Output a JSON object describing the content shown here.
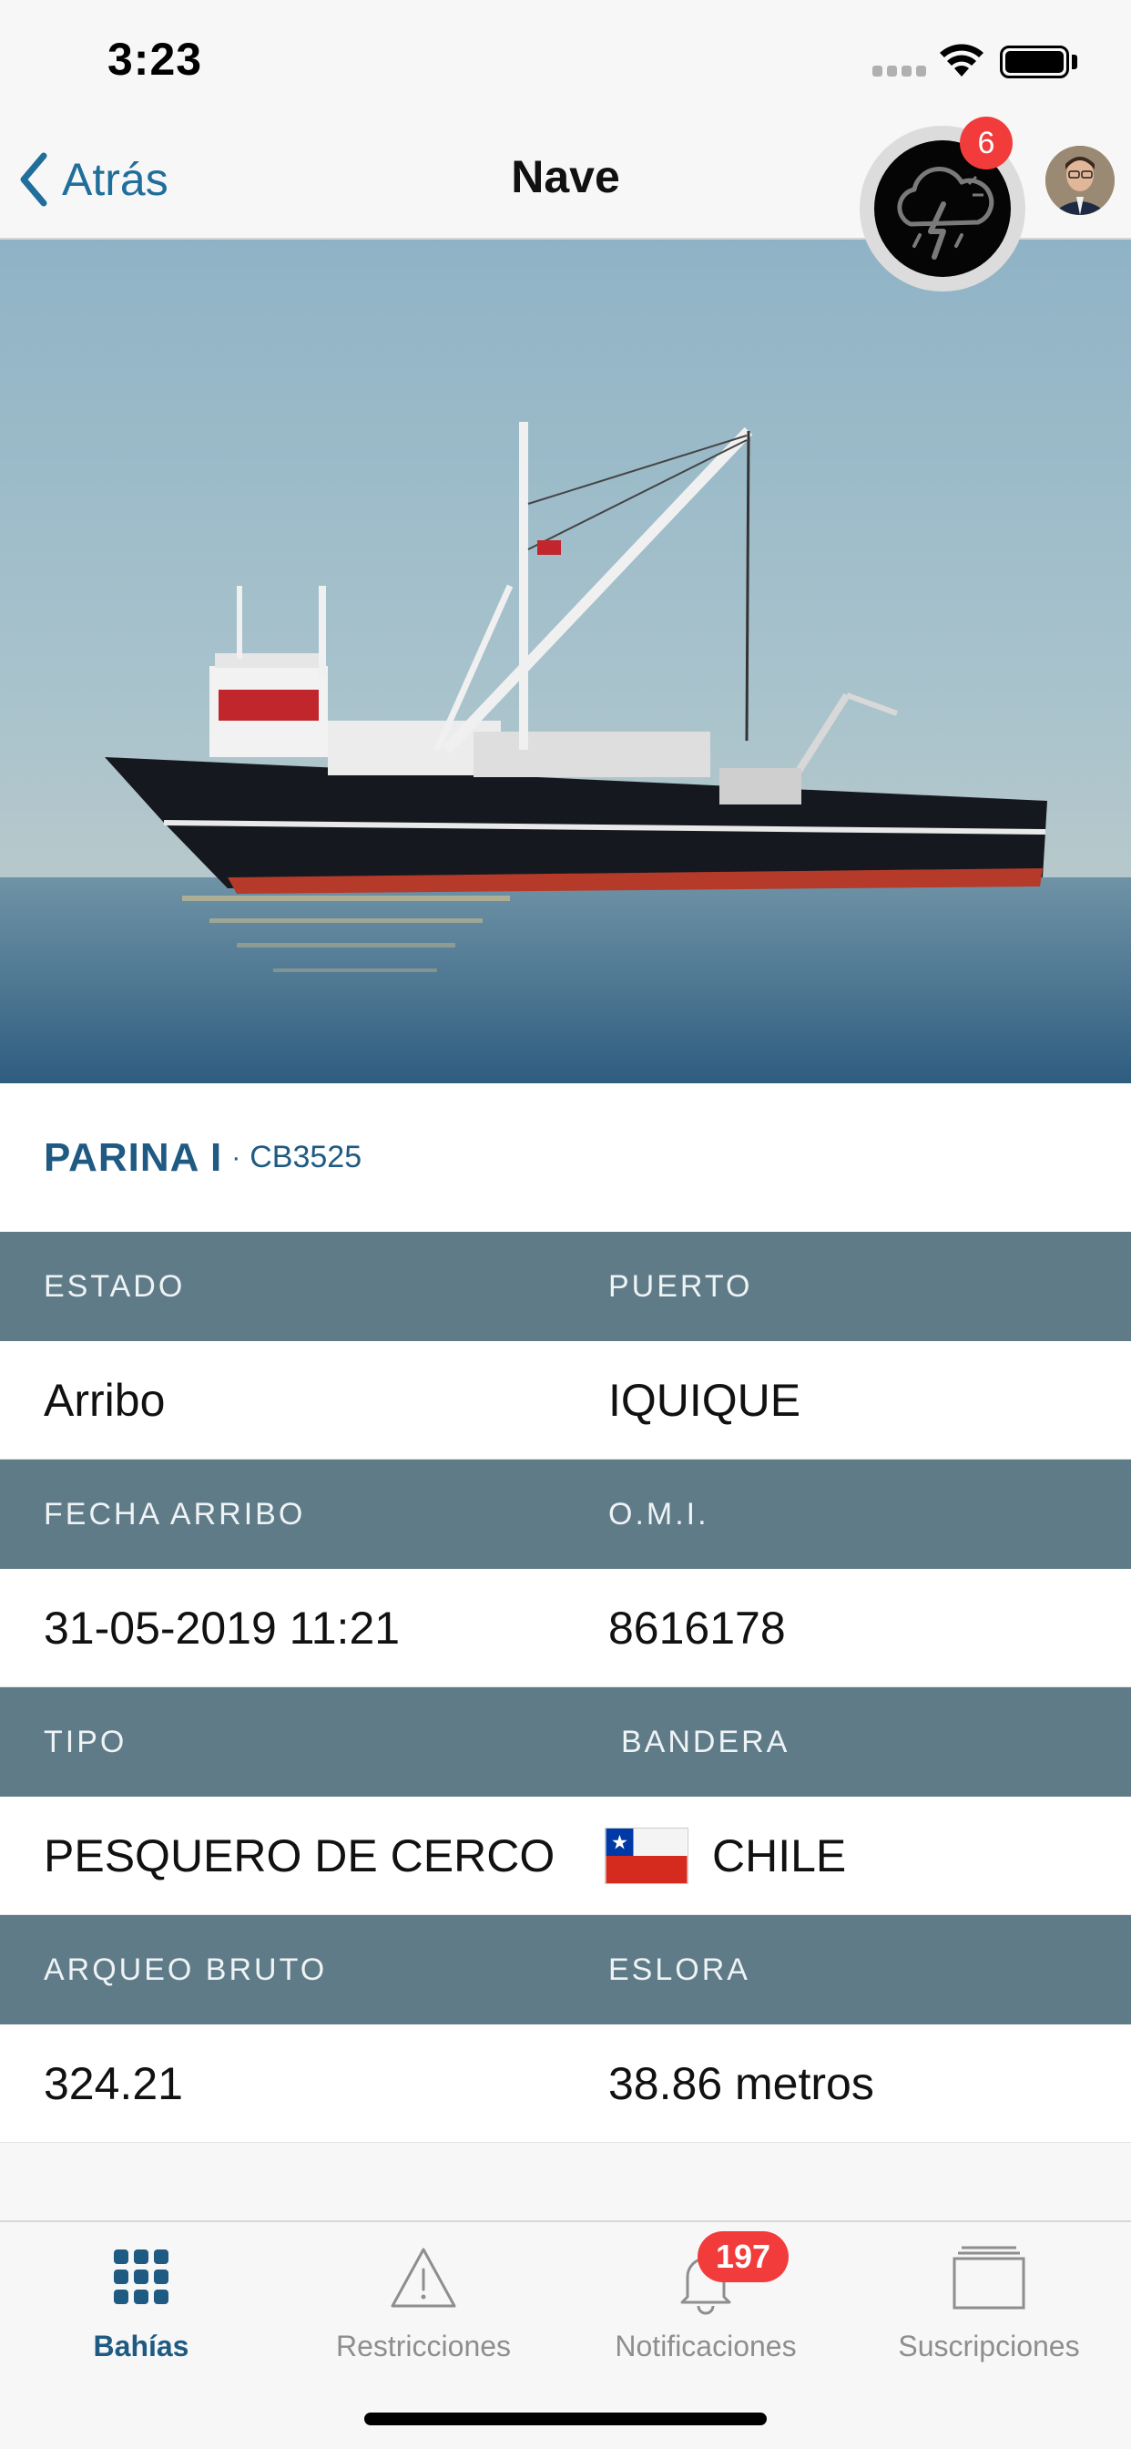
{
  "status_bar": {
    "time": "3:23"
  },
  "nav": {
    "back_label": "Atrás",
    "title": "Nave",
    "weather_badge": "6"
  },
  "ship": {
    "name": "PARINA I",
    "separator": "·",
    "code": "CB3525",
    "photo_icon": "ship-photo"
  },
  "details": [
    {
      "left_label": "ESTADO",
      "right_label": "PUERTO",
      "left_value": "Arribo",
      "right_value": "IQUIQUE"
    },
    {
      "left_label": "FECHA ARRIBO",
      "right_label": "O.M.I.",
      "left_value": "31-05-2019 11:21",
      "right_value": "8616178"
    },
    {
      "left_label": "TIPO",
      "right_label": "BANDERA",
      "left_value": "PESQUERO DE CERCO",
      "right_value": "CHILE"
    },
    {
      "left_label": "ARQUEO BRUTO",
      "right_label": "ESLORA",
      "left_value": "324.21",
      "right_value": "38.86 metros"
    }
  ],
  "tabs": [
    {
      "label": "Bahías",
      "icon": "grid-icon",
      "active": true
    },
    {
      "label": "Restricciones",
      "icon": "warning-icon"
    },
    {
      "label": "Notificaciones",
      "icon": "bell-icon",
      "badge": "197"
    },
    {
      "label": "Suscripciones",
      "icon": "folder-icon"
    }
  ],
  "colors": {
    "accent": "#1f5a82",
    "header_row": "#5f7b88",
    "badge": "#f23c3c"
  }
}
